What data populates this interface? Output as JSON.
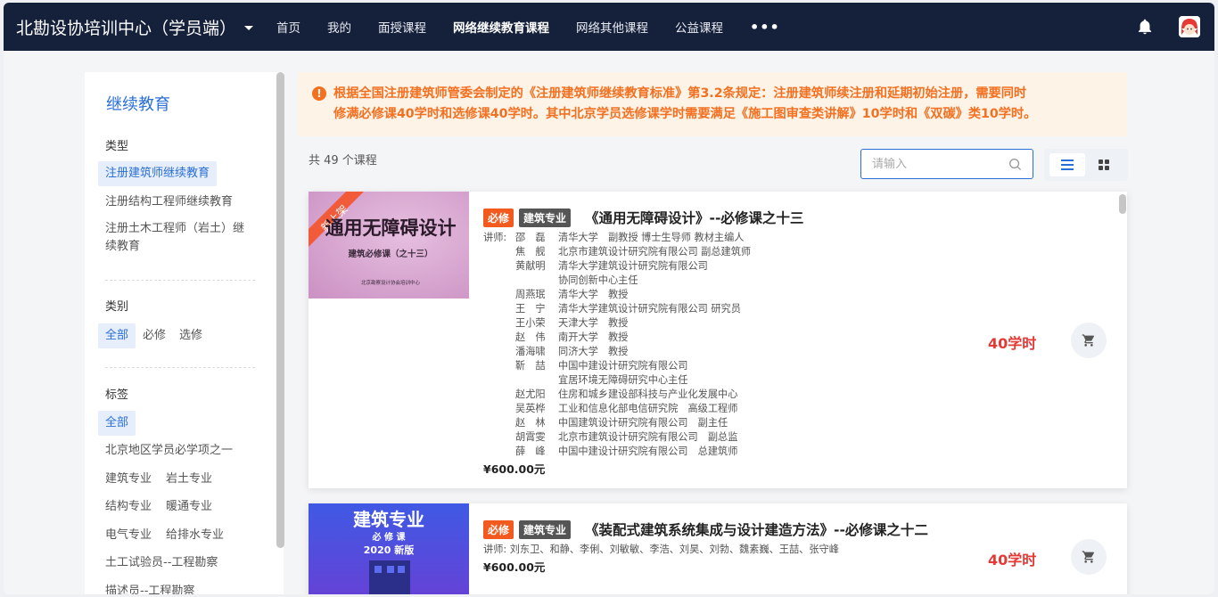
{
  "header": {
    "brand": "北勘设协培训中心（学员端）",
    "nav": [
      "首页",
      "我的",
      "面授课程",
      "网络继续教育课程",
      "网络其他课程",
      "公益课程"
    ],
    "active_index": 3,
    "more": "•••",
    "bell_icon": "bell-icon",
    "avatar_icon": "avatar-icon"
  },
  "sidebar": {
    "title": "继续教育",
    "type_label": "类型",
    "types": [
      "注册建筑师继续教育",
      "注册结构工程师继续教育",
      "注册土木工程师（岩土）继",
      "续教育"
    ],
    "category_label": "类别",
    "categories": [
      "全部",
      "必修",
      "选修"
    ],
    "tag_label": "标签",
    "tags": [
      "全部",
      "北京地区学员必学项之一",
      "建筑专业",
      "岩土专业",
      "结构专业",
      "暖通专业",
      "电气专业",
      "给排水专业",
      "土工试验员--工程勘察",
      "描述员--工程勘察"
    ]
  },
  "notice": {
    "line1": "根据全国注册建筑师管委会制定的《注册建筑师继续教育标准》第3.2条规定：注册建筑师续注册和延期初始注册，需要同时",
    "line2": "修满必修课40学时和选修课40学时。其中北京学员选修课学时需要满足《施工图审查类讲解》10学时和《双碳》类10学时。"
  },
  "list": {
    "count": "共 49 个课程",
    "search_placeholder": "请输入",
    "colors": {
      "accent": "#2a6fd6",
      "warning": "#f37021",
      "hours": "#e53935",
      "nav_bg": "#15203a"
    }
  },
  "courses": [
    {
      "thumb_title": "通用无障碍设计",
      "thumb_sub": "建筑必修课（之十三）",
      "thumb_org": "北京勘察设计协会培训中心",
      "ribbon": "新上架",
      "badge_req": "必修",
      "badge_spec": "建筑专业",
      "title": "《通用无障碍设计》--必修课之十三",
      "teacher_label": "讲师:",
      "teachers": [
        [
          "邵　磊",
          "清华大学　副教授 博士生导师 教材主编人"
        ],
        [
          "焦　舰",
          "北京市建筑设计研究院有限公司 副总建筑师"
        ],
        [
          "黄献明",
          "清华大学建筑设计研究院有限公司"
        ],
        [
          "",
          "协同创新中心主任"
        ],
        [
          "周燕珉",
          "清华大学　教授"
        ],
        [
          "王　宁",
          "清华大学建筑设计研究院有限公司 研究员"
        ],
        [
          "王小荣",
          "天津大学　教授"
        ],
        [
          "赵　伟",
          "南开大学　教授"
        ],
        [
          "潘海啸",
          "同济大学　教授"
        ],
        [
          "靳　喆",
          "中国中建设计研究院有限公司"
        ],
        [
          "",
          "宜居环境无障碍研究中心主任"
        ],
        [
          "赵尤阳",
          "住房和城乡建设部科技与产业化发展中心"
        ],
        [
          "吴英桦",
          "工业和信息化部电信研究院　高级工程师"
        ],
        [
          "赵　林",
          "中国建筑设计研究院有限公司　副主任"
        ],
        [
          "胡霄雯",
          "北京市建筑设计研究院有限公司　副总监"
        ],
        [
          "薛　峰",
          "中国中建设计研究院有限公司　总建筑师"
        ]
      ],
      "price": "¥600.00元",
      "hours": "40学时"
    },
    {
      "thumb_title": "建筑专业",
      "thumb_sub": "必 修 课",
      "thumb_org": "2020 新版",
      "badge_req": "必修",
      "badge_spec": "建筑专业",
      "title": "《装配式建筑系统集成与设计建造方法》--必修课之十二",
      "teachers_line": "讲师: 刘东卫、和静、李俐、刘敏敏、李浩、刘昊、刘勃、魏素巍、王喆、张守峰",
      "price": "¥600.00元",
      "hours": "40学时"
    }
  ]
}
